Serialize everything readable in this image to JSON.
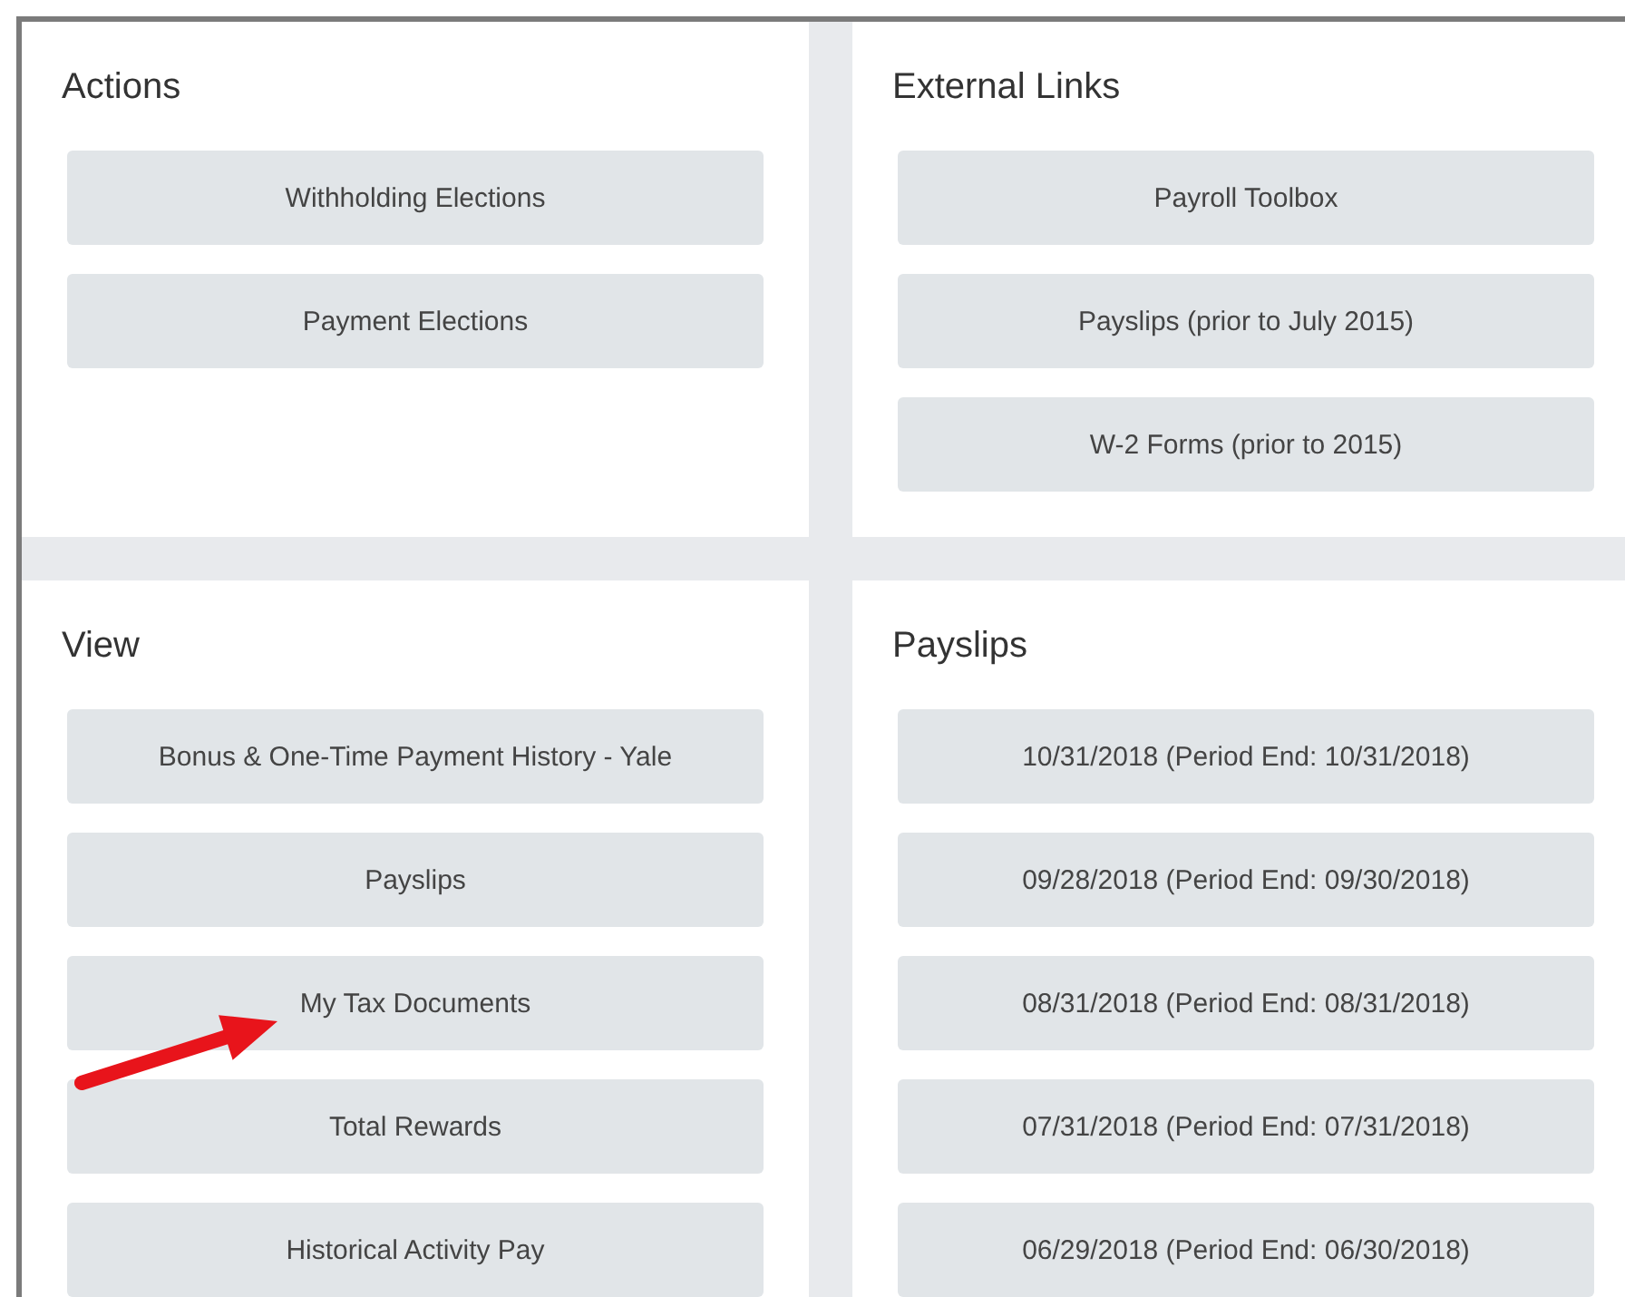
{
  "panels": [
    {
      "title": "Actions",
      "buttons": [
        {
          "label": "Withholding Elections",
          "pointer_arrow": false
        },
        {
          "label": "Payment Elections",
          "pointer_arrow": false
        }
      ]
    },
    {
      "title": "External Links",
      "buttons": [
        {
          "label": "Payroll Toolbox",
          "pointer_arrow": false
        },
        {
          "label": "Payslips (prior to July 2015)",
          "pointer_arrow": false
        },
        {
          "label": "W-2 Forms (prior to 2015)",
          "pointer_arrow": false
        }
      ]
    },
    {
      "title": "View",
      "buttons": [
        {
          "label": "Bonus & One-Time Payment History - Yale",
          "pointer_arrow": false
        },
        {
          "label": "Payslips",
          "pointer_arrow": false
        },
        {
          "label": "My Tax Documents",
          "pointer_arrow": true
        },
        {
          "label": "Total Rewards",
          "pointer_arrow": false
        },
        {
          "label": "Historical Activity Pay",
          "pointer_arrow": false
        }
      ]
    },
    {
      "title": "Payslips",
      "buttons": [
        {
          "label": "10/31/2018 (Period End: 10/31/2018)",
          "pointer_arrow": false
        },
        {
          "label": "09/28/2018 (Period End: 09/30/2018)",
          "pointer_arrow": false
        },
        {
          "label": "08/31/2018 (Period End: 08/31/2018)",
          "pointer_arrow": false
        },
        {
          "label": "07/31/2018 (Period End: 07/31/2018)",
          "pointer_arrow": false
        },
        {
          "label": "06/29/2018 (Period End: 06/30/2018)",
          "pointer_arrow": false
        }
      ]
    }
  ]
}
